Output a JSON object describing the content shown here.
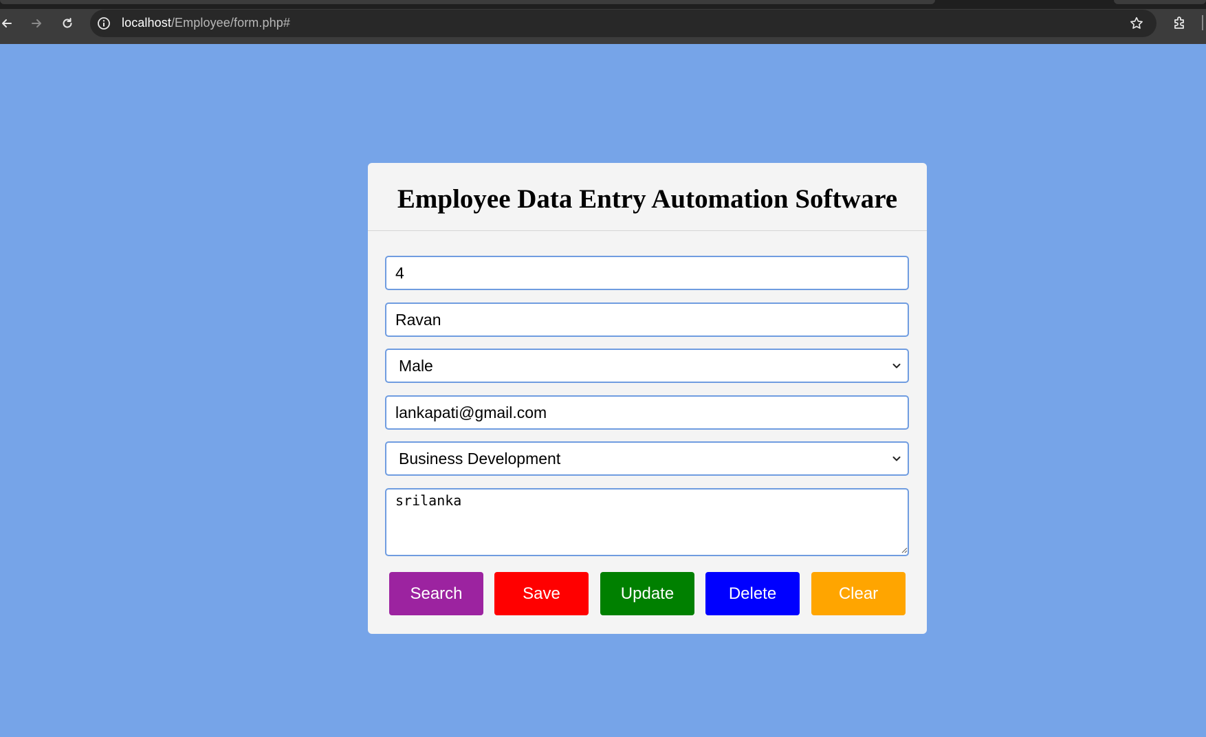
{
  "browser": {
    "url_host": "localhost",
    "url_path": "/Employee/form.php#"
  },
  "form": {
    "title": "Employee Data Entry Automation Software",
    "fields": {
      "id": "4",
      "name": "Ravan",
      "gender": "Male",
      "email": "lankapati@gmail.com",
      "department": "Business Development",
      "address": "srilanka"
    }
  },
  "buttons": {
    "search": {
      "label": "Search",
      "color": "#9c23a0"
    },
    "save": {
      "label": "Save",
      "color": "#ff0000"
    },
    "update": {
      "label": "Update",
      "color": "#008000"
    },
    "delete": {
      "label": "Delete",
      "color": "#0000ff"
    },
    "clear": {
      "label": "Clear",
      "color": "#ffa500"
    }
  },
  "colors": {
    "page_background": "#76a4e8",
    "card_background": "#f4f4f4",
    "field_border": "#6f9ce0"
  }
}
